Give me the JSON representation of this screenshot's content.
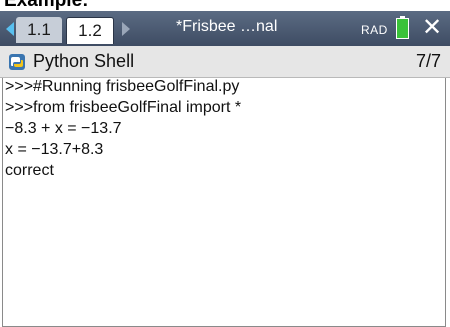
{
  "caption": "Example:",
  "topbar": {
    "tabs": [
      {
        "label": "1.1",
        "active": false
      },
      {
        "label": "1.2",
        "active": true
      }
    ],
    "document_title": "*Frisbee …nal",
    "angle_mode": "RAD"
  },
  "shell": {
    "title": "Python Shell",
    "page_indicator": "7/7"
  },
  "console": {
    "lines": [
      ">>>#Running frisbeeGolfFinal.py",
      ">>>from frisbeeGolfFinal import *",
      "−8.3 + x = −13.7",
      "x = −13.7+8.3",
      "correct"
    ]
  },
  "colors": {
    "topbar": "#4b5a72",
    "accent_arrow": "#58c0f0",
    "battery": "#3ac23a",
    "python_blue": "#3a75b0",
    "python_yellow": "#f5c518"
  }
}
